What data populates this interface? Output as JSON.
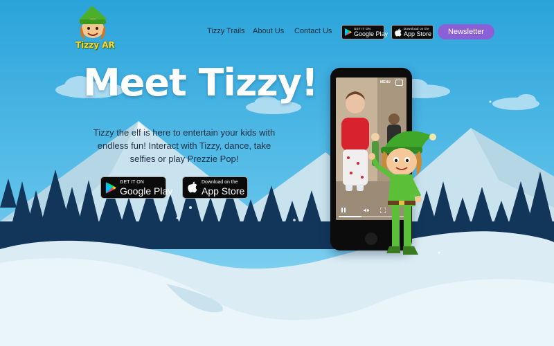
{
  "brand": {
    "logo_text": "Tizzy AR"
  },
  "nav": {
    "links": [
      "Tizzy Trails",
      "About Us",
      "Contact Us"
    ],
    "google_play": {
      "small": "GET IT ON",
      "large": "Google Play"
    },
    "app_store": {
      "small": "Download on the",
      "large": "App Store"
    },
    "newsletter": "Newsletter"
  },
  "hero": {
    "title": "Meet Tizzy!",
    "description": "Tizzy the elf is here to entertain your kids with endless fun! Interact with Tizzy, dance, take selfies or play Prezzie Pop!",
    "google_play": {
      "small": "GET IT ON",
      "large": "Google Play"
    },
    "app_store": {
      "small": "Download on the",
      "large": "App Store"
    }
  },
  "phone": {
    "menu_label": "MENU",
    "video_progress": 0.35
  },
  "colors": {
    "sky_top": "#2aa6dc",
    "sky_bottom": "#8fd6f2",
    "accent": "#8b5fd6",
    "tree": "#12365a",
    "mountain": "#cde5ee",
    "snow": "#eef8fc"
  },
  "icons": [
    "google-play-icon",
    "apple-icon",
    "play-pause-icon",
    "mute-icon",
    "fullscreen-icon",
    "camera-icon"
  ]
}
